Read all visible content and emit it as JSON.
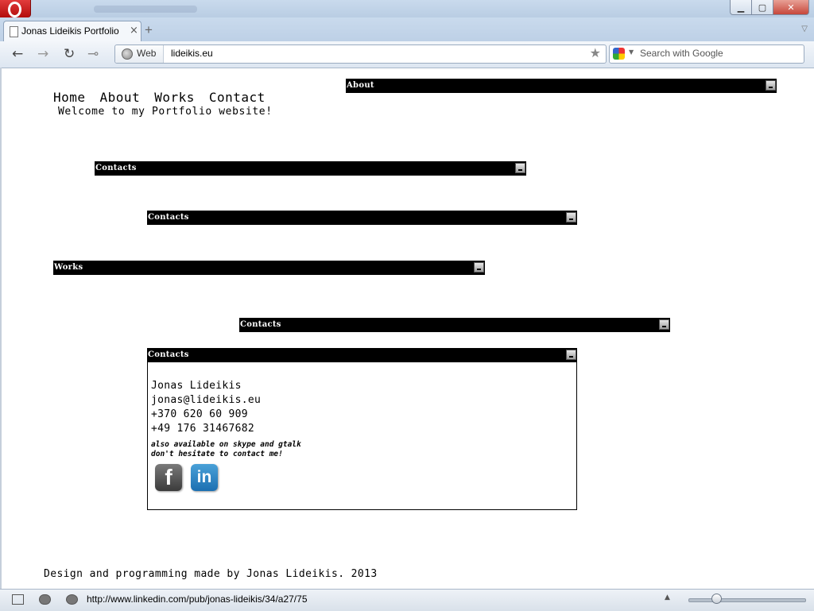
{
  "browser": {
    "tab_title": "Jonas Lideikis Portfolio",
    "tab_close": "×",
    "new_tab": "+",
    "web_label": "Web",
    "url": "lideikis.eu",
    "search_placeholder": "Search with Google",
    "status_url": "http://www.linkedin.com/pub/jonas-lideikis/34/a27/75",
    "zoom_level": 0.24
  },
  "site": {
    "nav": [
      "Home",
      "About",
      "Works",
      "Contact"
    ],
    "welcome": "Welcome to my Portfolio website!",
    "panels": {
      "about": "About",
      "contacts_1": "Contacts",
      "contacts_2": "Contacts",
      "works": "Works",
      "contacts_3": "Contacts",
      "contacts_open": "Contacts"
    },
    "contact": {
      "name": "Jonas Lideikis",
      "email": "jonas@lideikis.eu",
      "phone_1": "+370 620 60 909",
      "phone_2": "+49 176 31467682",
      "note_1": "also available on skype and gtalk",
      "note_2": "don't hesitate to contact me!",
      "facebook_icon": "f",
      "linkedin_icon": "in"
    },
    "footer": "Design and programming made by Jonas Lideikis. 2013"
  }
}
